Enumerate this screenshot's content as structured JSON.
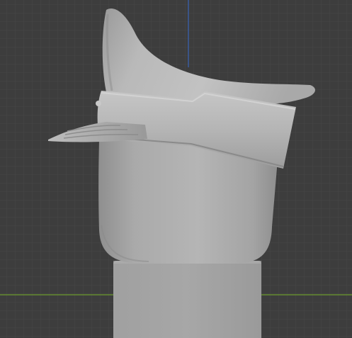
{
  "app": {
    "view": "3D viewport"
  },
  "scene": {
    "background_color": "#3d3d3d",
    "grid_minor_color": "#474747",
    "grid_major_color": "#4f4f4f",
    "axis_x_color": "#6b9a2e",
    "axis_z_color": "#3a63b8",
    "model": {
      "description_name": "hat-on-head-model",
      "head_color": "#a7a7a7",
      "cap_color": "#b3b3b3",
      "band_color": "#b8b8b8",
      "visor_color": "#9f9f9f",
      "base_color": "#a2a2a2"
    }
  }
}
